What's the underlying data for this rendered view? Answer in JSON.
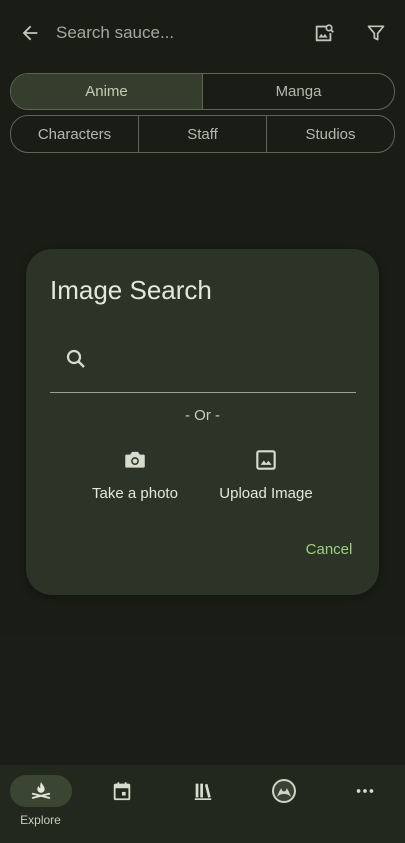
{
  "header": {
    "search_placeholder": "Search sauce..."
  },
  "type_tabs": [
    {
      "label": "Anime",
      "active": true
    },
    {
      "label": "Manga",
      "active": false
    }
  ],
  "entity_tabs": [
    {
      "label": "Characters"
    },
    {
      "label": "Staff"
    },
    {
      "label": "Studios"
    }
  ],
  "dialog": {
    "title": "Image Search",
    "search_value": "",
    "or_text": "- Or -",
    "take_photo_label": "Take a photo",
    "upload_label": "Upload Image",
    "cancel_label": "Cancel"
  },
  "bottom_nav": {
    "explore_label": "Explore"
  },
  "colors": {
    "background": "#1d2119",
    "dialog": "#2c3327",
    "accent": "#9fcf7d",
    "active_tab": "#3b4632"
  }
}
